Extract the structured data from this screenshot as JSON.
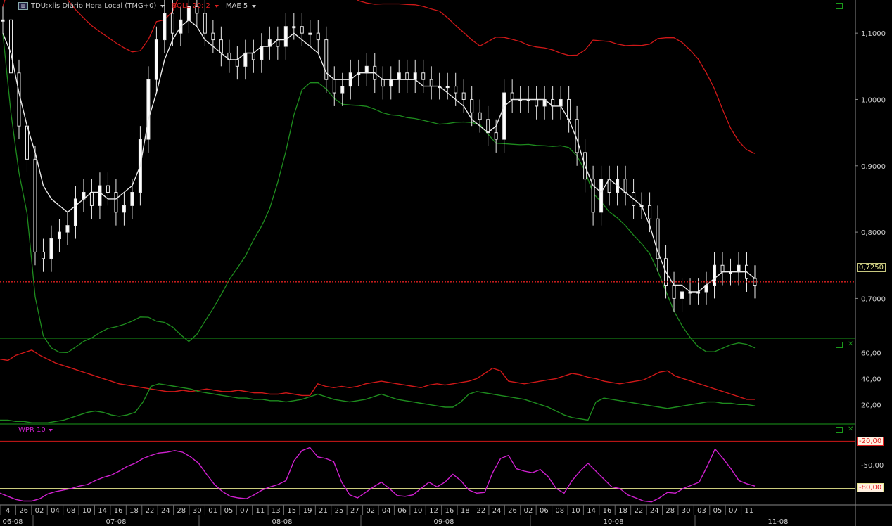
{
  "legend": {
    "symbol_icon": "chart-icon",
    "symbol": "TDU:xlis Diário Hora Local (TMG+0)",
    "indicator1": "BOLL 20; 2",
    "indicator2": "MAE 5"
  },
  "wpr_legend": "WPR 10",
  "price_axis": [
    "1,1000",
    "1,0000",
    "0,9000",
    "0,8000",
    "0,7000"
  ],
  "current_price": "0,7250",
  "dmi_axis": [
    "60,00",
    "40,00",
    "20,00"
  ],
  "wpr_axis": [
    "-20,00",
    "-50,00",
    "-80,00"
  ],
  "date_ticks": [
    "4",
    "26",
    "02",
    "04",
    "08",
    "10",
    "14",
    "16",
    "18",
    "22",
    "24",
    "28",
    "30",
    "01",
    "05",
    "07",
    "11",
    "13",
    "15",
    "19",
    "21",
    "25",
    "27",
    "02",
    "04",
    "06",
    "10",
    "12",
    "16",
    "18",
    "22",
    "24",
    "26",
    "02",
    "06",
    "08",
    "10",
    "14",
    "16",
    "18",
    "22",
    "24",
    "28",
    "30",
    "03",
    "05",
    "07",
    "11"
  ],
  "month_labels": [
    "06-08",
    "07-08",
    "08-08",
    "09-08",
    "10-08",
    "11-08"
  ],
  "colors": {
    "upper_band": "#d01818",
    "lower_band": "#1e8c1e",
    "mae": "#e8e8e8",
    "candle": "#e8e8e8",
    "price_line": "#e02020",
    "dmi_plus": "#1e8c1e",
    "dmi_minus": "#d01818",
    "wpr": "#d020d0",
    "wpr_upper": "#d01818",
    "wpr_lower": "#e8e890",
    "grid_border": "#1a9a1a"
  },
  "chart_data": [
    {
      "type": "candlestick",
      "title": "TDU:xlis Diário Hora Local (TMG+0)",
      "ylim": [
        0.64,
        1.15
      ],
      "close": [
        1.12,
        1.04,
        0.96,
        0.91,
        0.77,
        0.76,
        0.79,
        0.8,
        0.81,
        0.85,
        0.86,
        0.84,
        0.87,
        0.86,
        0.83,
        0.84,
        0.86,
        0.94,
        1.03,
        1.09,
        1.13,
        1.1,
        1.12,
        1.14,
        1.13,
        1.1,
        1.09,
        1.07,
        1.06,
        1.05,
        1.07,
        1.06,
        1.08,
        1.09,
        1.08,
        1.11,
        1.11,
        1.1,
        1.1,
        1.09,
        1.03,
        1.01,
        1.02,
        1.04,
        1.04,
        1.05,
        1.03,
        1.02,
        1.03,
        1.04,
        1.03,
        1.04,
        1.03,
        1.02,
        1.02,
        1.02,
        1.01,
        1.0,
        0.98,
        0.97,
        0.95,
        0.94,
        1.01,
        1.0,
        1.0,
        1.0,
        0.99,
        1.0,
        0.99,
        1.0,
        0.97,
        0.92,
        0.88,
        0.83,
        0.88,
        0.86,
        0.88,
        0.86,
        0.84,
        0.84,
        0.82,
        0.76,
        0.72,
        0.7,
        0.71,
        0.71,
        0.71,
        0.72,
        0.75,
        0.74,
        0.74,
        0.75,
        0.73,
        0.72
      ],
      "mae5": [
        1.1,
        1.07,
        1.01,
        0.96,
        0.92,
        0.87,
        0.85,
        0.84,
        0.83,
        0.84,
        0.85,
        0.86,
        0.86,
        0.85,
        0.85,
        0.86,
        0.87,
        0.9,
        0.97,
        1.01,
        1.06,
        1.09,
        1.11,
        1.12,
        1.11,
        1.09,
        1.08,
        1.07,
        1.06,
        1.06,
        1.07,
        1.07,
        1.08,
        1.08,
        1.09,
        1.09,
        1.1,
        1.09,
        1.08,
        1.07,
        1.04,
        1.03,
        1.03,
        1.03,
        1.04,
        1.04,
        1.04,
        1.03,
        1.03,
        1.03,
        1.03,
        1.03,
        1.02,
        1.02,
        1.02,
        1.01,
        1.0,
        0.99,
        0.97,
        0.96,
        0.95,
        0.96,
        0.99,
        1.0,
        1.0,
        1.0,
        1.0,
        1.0,
        0.99,
        0.99,
        0.97,
        0.94,
        0.9,
        0.87,
        0.86,
        0.88,
        0.87,
        0.86,
        0.85,
        0.84,
        0.81,
        0.77,
        0.74,
        0.72,
        0.72,
        0.71,
        0.71,
        0.72,
        0.73,
        0.74,
        0.74,
        0.74,
        0.74,
        0.73
      ],
      "bollinger_upper": [
        null,
        null,
        null,
        null,
        null,
        null,
        null,
        null,
        null,
        null,
        null,
        null,
        null,
        null,
        null,
        null,
        null,
        null,
        null,
        null,
        null,
        null,
        null,
        null,
        null,
        null,
        null,
        null,
        null,
        null,
        null,
        null,
        null,
        null,
        null,
        null,
        null,
        null,
        null,
        null,
        null,
        null,
        null,
        null,
        null,
        null,
        null,
        null,
        null,
        null,
        null,
        null,
        null,
        null,
        null,
        null,
        null,
        null,
        null,
        null,
        null,
        null,
        null,
        null,
        null,
        null,
        null,
        null,
        null,
        null,
        null,
        null,
        null,
        null,
        null,
        null,
        null,
        null,
        null,
        null,
        null,
        null,
        null,
        null,
        null,
        null,
        null,
        null,
        null,
        null,
        null,
        null,
        null,
        null
      ],
      "bollinger_lower_shape": "see script"
    },
    {
      "type": "line",
      "title": "",
      "ylim": [
        5,
        70
      ],
      "series": [
        {
          "values": [
            55,
            54,
            58,
            60,
            62,
            58,
            55,
            52,
            50,
            48,
            46,
            44,
            42,
            40,
            38,
            36,
            35,
            34,
            33,
            32,
            31,
            30,
            30,
            31,
            30,
            31,
            32,
            31,
            30,
            30,
            31,
            30,
            29,
            29,
            28,
            28,
            29,
            28,
            27,
            27,
            36,
            34,
            33,
            34,
            33,
            34,
            36,
            37,
            38,
            37,
            36,
            35,
            34,
            33,
            35,
            36,
            35,
            36,
            37,
            38,
            40,
            44,
            48,
            46,
            38,
            37,
            36,
            37,
            38,
            39,
            40,
            42,
            44,
            43,
            41,
            40,
            38,
            37,
            36,
            37,
            38,
            39,
            42,
            45,
            46,
            42,
            40,
            38,
            36,
            34,
            32,
            30,
            28,
            26,
            24,
            24
          ]
        },
        {
          "values": [
            8,
            8,
            7,
            7,
            6,
            6,
            6,
            7,
            8,
            10,
            12,
            14,
            15,
            14,
            12,
            11,
            12,
            14,
            22,
            34,
            36,
            35,
            34,
            33,
            32,
            30,
            29,
            28,
            27,
            26,
            25,
            25,
            24,
            24,
            23,
            23,
            22,
            23,
            24,
            26,
            28,
            26,
            24,
            23,
            22,
            23,
            24,
            26,
            28,
            26,
            24,
            23,
            22,
            21,
            20,
            19,
            18,
            18,
            22,
            28,
            30,
            29,
            28,
            27,
            26,
            25,
            24,
            22,
            20,
            18,
            15,
            12,
            10,
            9,
            8,
            22,
            25,
            24,
            23,
            22,
            21,
            20,
            19,
            18,
            17,
            18,
            19,
            20,
            21,
            22,
            22,
            21,
            21,
            20,
            20,
            19
          ]
        }
      ]
    },
    {
      "type": "line",
      "title": "WPR 10",
      "ylim": [
        -100,
        0
      ],
      "series": [
        {
          "values": [
            -86,
            -90,
            -94,
            -96,
            -96,
            -93,
            -87,
            -84,
            -82,
            -80,
            -77,
            -75,
            -70,
            -66,
            -63,
            -58,
            -52,
            -48,
            -42,
            -38,
            -35,
            -34,
            -32,
            -34,
            -40,
            -48,
            -62,
            -75,
            -84,
            -90,
            -92,
            -93,
            -88,
            -82,
            -78,
            -75,
            -70,
            -45,
            -32,
            -28,
            -40,
            -42,
            -46,
            -72,
            -88,
            -92,
            -85,
            -78,
            -72,
            -80,
            -89,
            -90,
            -88,
            -80,
            -72,
            -78,
            -72,
            -62,
            -70,
            -82,
            -86,
            -85,
            -60,
            -42,
            -38,
            -55,
            -58,
            -60,
            -56,
            -65,
            -80,
            -86,
            -70,
            -58,
            -48,
            -58,
            -68,
            -78,
            -80,
            -88,
            -92,
            -96,
            -97,
            -92,
            -85,
            -86,
            -80,
            -76,
            -72,
            -52,
            -30,
            -42,
            -55,
            -70,
            -74,
            -77
          ]
        }
      ]
    }
  ]
}
